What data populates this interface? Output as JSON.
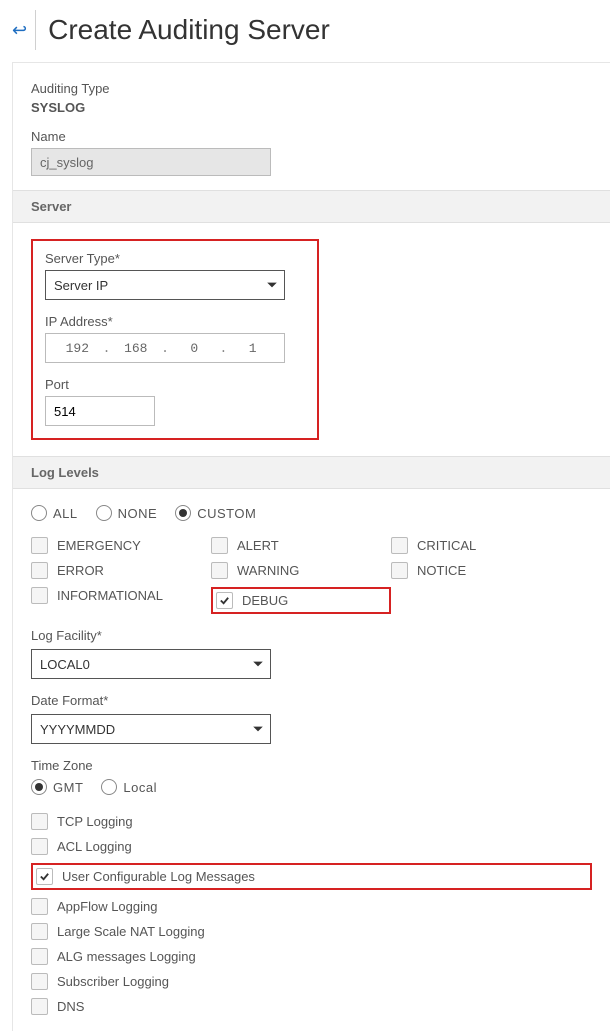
{
  "header": {
    "title": "Create Auditing Server"
  },
  "auditing": {
    "type_label": "Auditing Type",
    "type_value": "SYSLOG",
    "name_label": "Name",
    "name_value": "cj_syslog"
  },
  "server": {
    "section_title": "Server",
    "server_type_label": "Server Type*",
    "server_type_value": "Server IP",
    "ip_label": "IP Address*",
    "ip_octets": [
      "192",
      "168",
      "0",
      "1"
    ],
    "port_label": "Port",
    "port_value": "514"
  },
  "loglevels": {
    "section_title": "Log Levels",
    "radios": {
      "all": "ALL",
      "none": "NONE",
      "custom": "CUSTOM",
      "selected": "custom"
    },
    "checks": {
      "emergency": "EMERGENCY",
      "alert": "ALERT",
      "critical": "CRITICAL",
      "error": "ERROR",
      "warning": "WARNING",
      "notice": "NOTICE",
      "informational": "INFORMATIONAL",
      "debug": "DEBUG"
    },
    "log_facility_label": "Log Facility*",
    "log_facility_value": "LOCAL0",
    "date_format_label": "Date Format*",
    "date_format_value": "YYYYMMDD",
    "timezone_label": "Time Zone",
    "timezone": {
      "gmt": "GMT",
      "local": "Local",
      "selected": "gmt"
    },
    "options": {
      "tcp": "TCP Logging",
      "acl": "ACL Logging",
      "ucm": "User Configurable Log Messages",
      "appflow": "AppFlow Logging",
      "lsnat": "Large Scale NAT Logging",
      "alg": "ALG messages Logging",
      "subscriber": "Subscriber Logging",
      "dns": "DNS"
    }
  }
}
